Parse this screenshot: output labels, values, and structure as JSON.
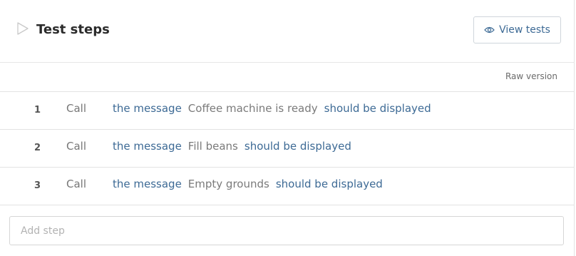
{
  "header": {
    "title": "Test steps",
    "view_tests_label": "View tests"
  },
  "raw_version_label": "Raw version",
  "steps": [
    {
      "number": "1",
      "keyword": "Call",
      "action": "the message",
      "param": "Coffee machine is ready",
      "assertion": "should be displayed"
    },
    {
      "number": "2",
      "keyword": "Call",
      "action": "the message",
      "param": "Fill beans",
      "assertion": "should be displayed"
    },
    {
      "number": "3",
      "keyword": "Call",
      "action": "the message",
      "param": "Empty grounds",
      "assertion": "should be displayed"
    }
  ],
  "add_step": {
    "placeholder": "Add step",
    "value": ""
  },
  "colors": {
    "accent": "#3d6a95",
    "muted_text": "#7a7a7a",
    "border": "#e3e3e3"
  },
  "icons": {
    "header": "play-outline-icon",
    "view_tests": "eye-icon"
  }
}
